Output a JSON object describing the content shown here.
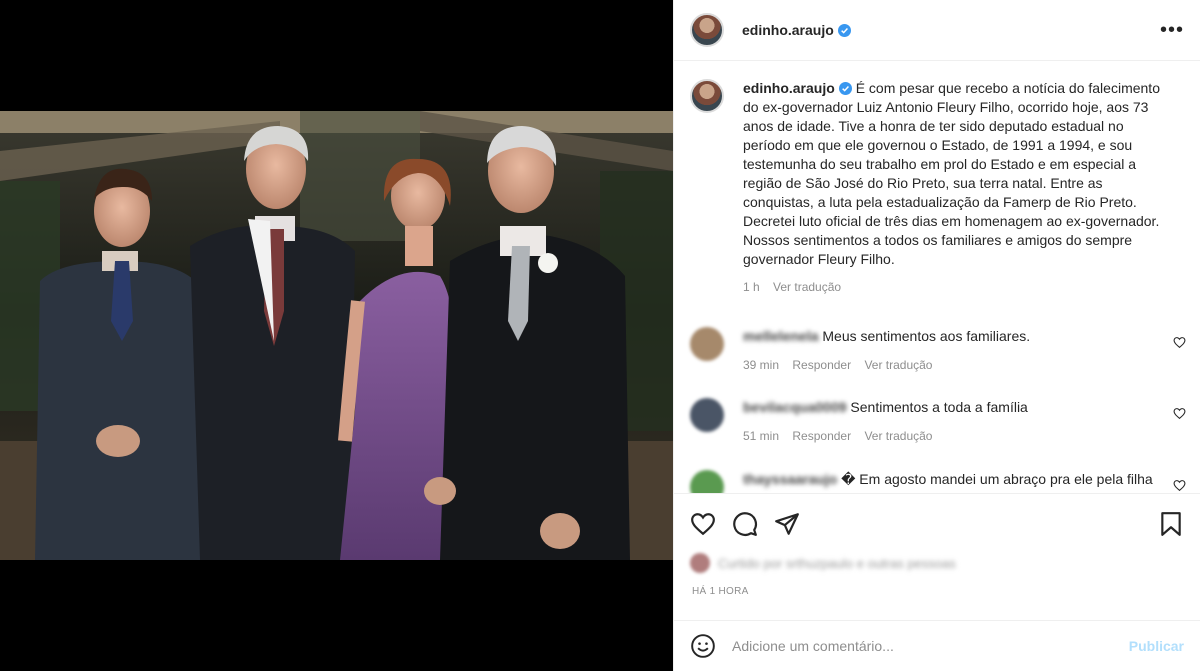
{
  "post": {
    "username": "edinho.araujo",
    "caption": "É com pesar que recebo a notícia do falecimento do ex-governador Luiz Antonio Fleury Filho, ocorrido hoje, aos 73 anos de idade. Tive a honra de ter sido deputado estadual no período em que ele governou o Estado, de 1991 a 1994, e sou testemunha do seu trabalho em prol do Estado e em especial a região de São José do Rio Preto, sua terra natal. Entre as conquistas, a luta pela estadualização da Famerp de Rio Preto. Decretei luto oficial de três dias em homenagem ao ex-governador. Nossos sentimentos a todos os familiares e amigos do sempre governador Fleury Filho.",
    "caption_time": "1 h",
    "see_translation": "Ver tradução",
    "more_icon": "more-horizontal-icon"
  },
  "comments": [
    {
      "username": "mellelenela",
      "text": "Meus sentimentos aos familiares.",
      "time": "39 min",
      "reply": "Responder",
      "translate": "Ver tradução",
      "avatar_color": "#a6896b"
    },
    {
      "username": "bevilacqua0009",
      "text": "Sentimentos a toda a família",
      "time": "51 min",
      "reply": "Responder",
      "translate": "Ver tradução",
      "avatar_color": "#4a5566"
    },
    {
      "username": "thayssaaraujo",
      "text": "� Em agosto mandei um abraço pra ele pela filha",
      "avatar_color": "#5a9a50"
    }
  ],
  "likes": {
    "text": "Curtido por srthuzpaulo e outras pessoas"
  },
  "timestamp": "HÁ 1 HORA",
  "add_comment": {
    "placeholder": "Adicione um comentário...",
    "publish": "Publicar"
  },
  "colors": {
    "verified": "#3897f0",
    "publish_disabled": "#b2dffc",
    "muted": "#8e8e8e"
  }
}
